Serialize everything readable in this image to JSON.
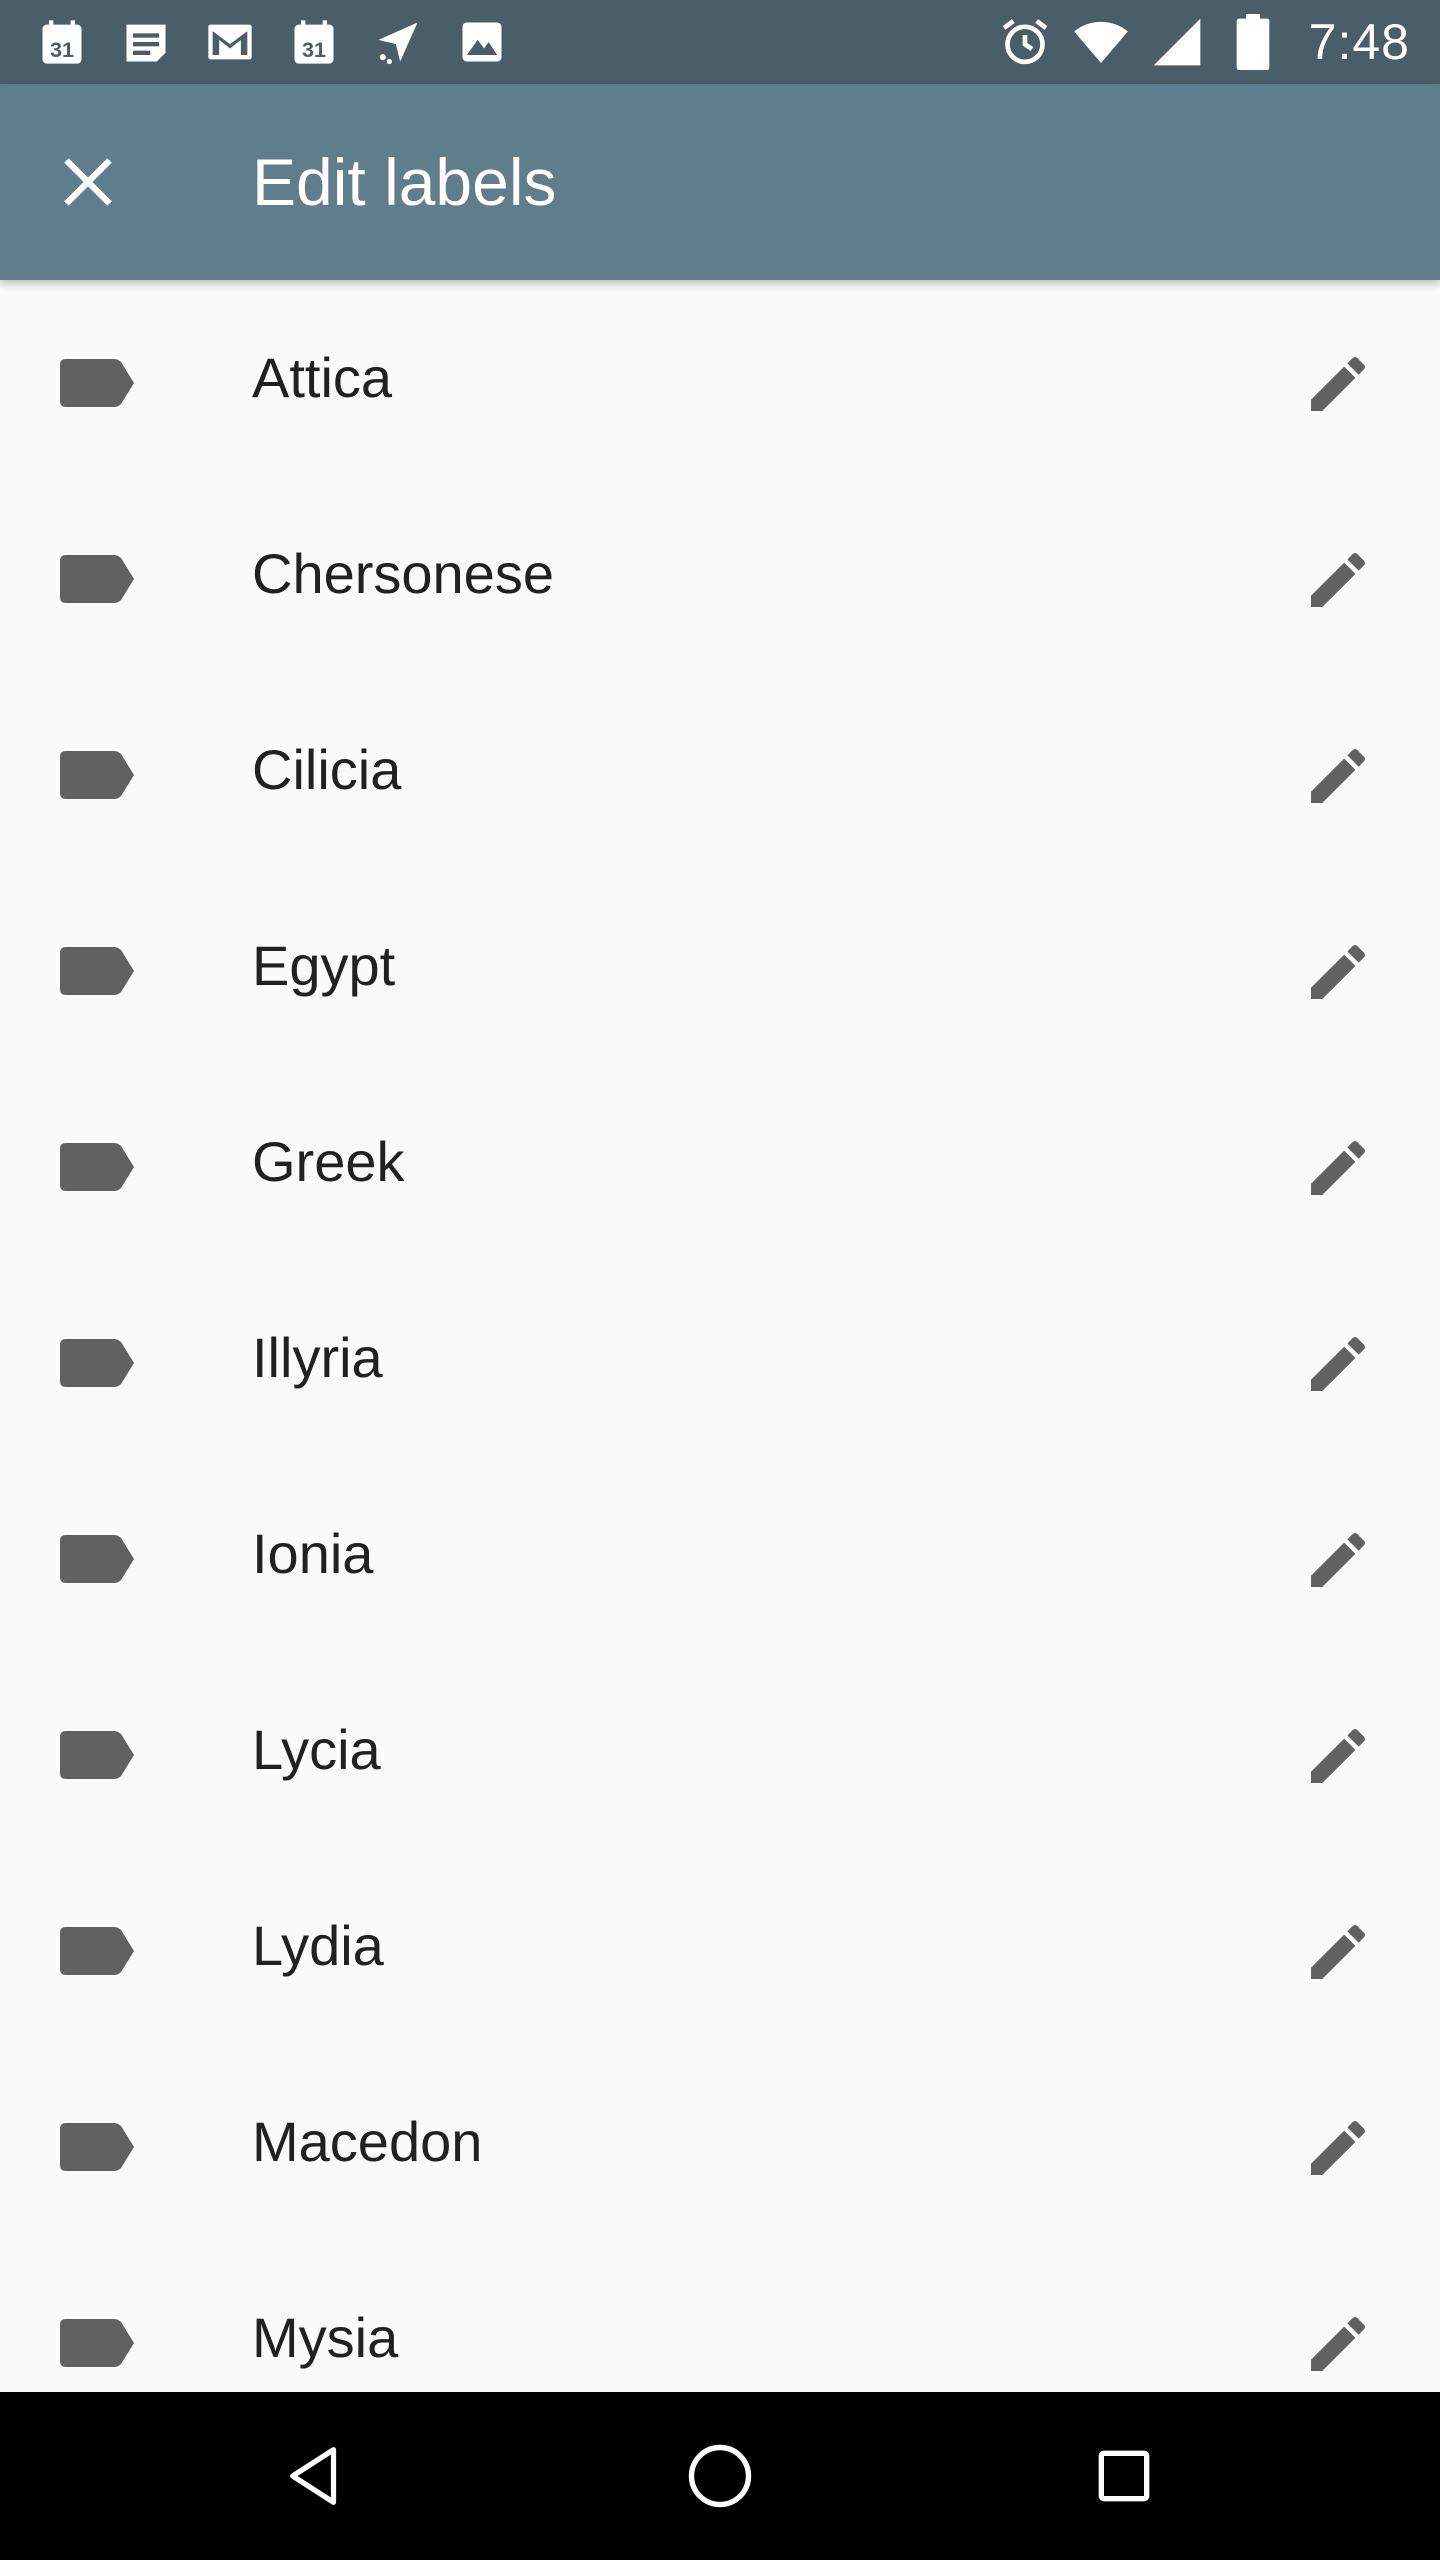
{
  "status_bar": {
    "time": "7:48",
    "background": "#4a5e69",
    "left_icons": [
      "calendar-icon",
      "news-icon",
      "gmail-icon",
      "calendar-icon",
      "location-icon",
      "image-icon"
    ],
    "right_icons": [
      "alarm-icon",
      "wifi-icon",
      "signal-icon",
      "battery-icon"
    ]
  },
  "app_bar": {
    "title": "Edit labels",
    "close_icon": "close-icon",
    "background": "#607d8b"
  },
  "labels": [
    {
      "name": "Attica"
    },
    {
      "name": "Chersonese"
    },
    {
      "name": "Cilicia"
    },
    {
      "name": "Egypt"
    },
    {
      "name": "Greek"
    },
    {
      "name": "Illyria"
    },
    {
      "name": "Ionia"
    },
    {
      "name": "Lycia"
    },
    {
      "name": "Lydia"
    },
    {
      "name": "Macedon"
    },
    {
      "name": "Mysia"
    }
  ],
  "row_icons": {
    "label": "label-icon",
    "edit": "pencil-icon"
  },
  "colors": {
    "icon_gray": "#616161",
    "text": "#212121",
    "list_background": "#fafafa"
  },
  "nav_bar": {
    "icons": [
      "back-icon",
      "home-icon",
      "recents-icon"
    ]
  }
}
